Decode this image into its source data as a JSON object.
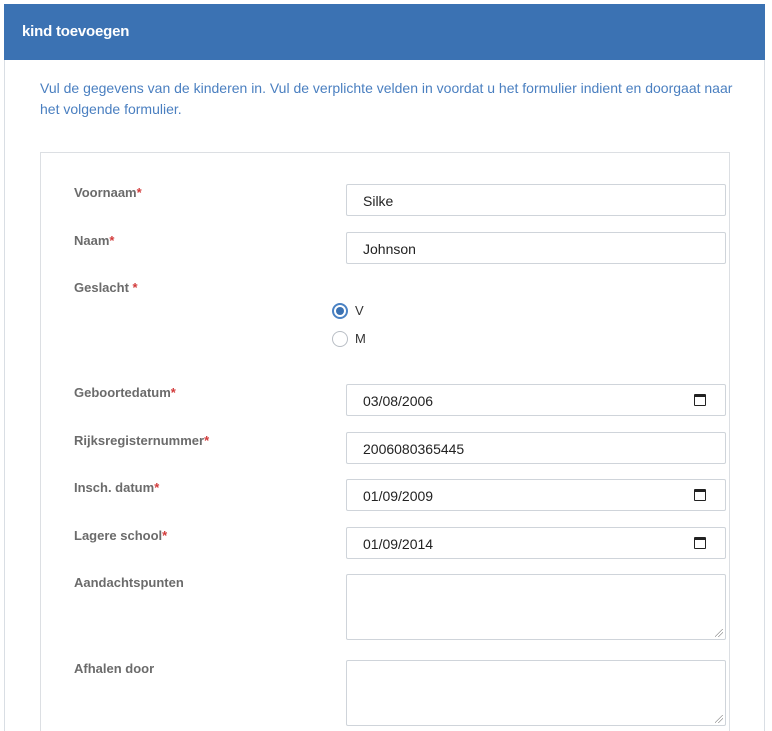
{
  "header": {
    "title": "kind toevoegen"
  },
  "intro": "Vul de gegevens van de kinderen in. Vul de verplichte velden in voordat u het formulier indient en doorgaat naar het volgende formulier.",
  "form": {
    "required_marker": "*",
    "voornaam": {
      "label": "Voornaam",
      "value": "Silke"
    },
    "naam": {
      "label": "Naam",
      "value": "Johnson"
    },
    "geslacht": {
      "label": "Geslacht ",
      "options": [
        {
          "label": "V",
          "checked": true
        },
        {
          "label": "M",
          "checked": false
        }
      ]
    },
    "geboortedatum": {
      "label": "Geboortedatum",
      "value": "03/08/2006"
    },
    "rijksregisternummer": {
      "label": "Rijksregisternummer",
      "value": "2006080365445"
    },
    "insch_datum": {
      "label": "Insch. datum",
      "value": "01/09/2009"
    },
    "lagere_school": {
      "label": "Lagere school",
      "value": "01/09/2014"
    },
    "aandachtspunten": {
      "label": "Aandachtspunten",
      "value": ""
    },
    "afhalen_door": {
      "label": "Afhalen door",
      "value": ""
    }
  }
}
